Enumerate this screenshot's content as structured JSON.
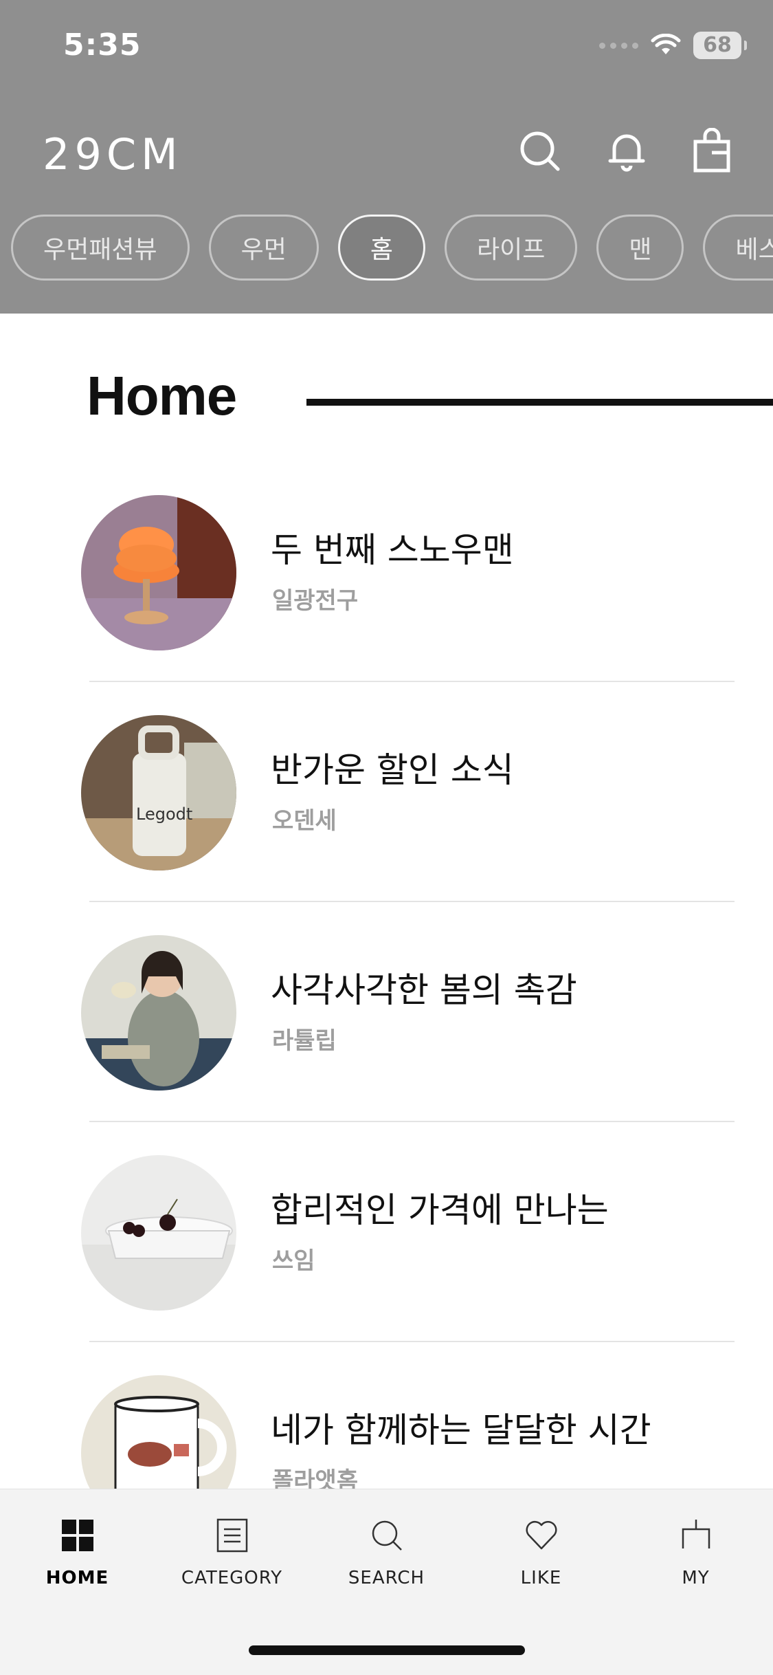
{
  "status_bar": {
    "time": "5:35",
    "battery": "68"
  },
  "header": {
    "logo": "29CM",
    "icons": [
      "search-icon",
      "bell-icon",
      "shopping-bag-icon"
    ],
    "chips": [
      {
        "label": "우먼패션뷰"
      },
      {
        "label": "우먼"
      },
      {
        "label": "홈",
        "active": true
      },
      {
        "label": "라이프"
      },
      {
        "label": "맨"
      },
      {
        "label": "베스"
      }
    ]
  },
  "section": {
    "title": "Home"
  },
  "items": [
    {
      "title": "두 번째 스노우맨",
      "brand": "일광전구"
    },
    {
      "title": "반가운 할인 소식",
      "brand": "오덴세"
    },
    {
      "title": "사각사각한 봄의 촉감",
      "brand": "라튤립"
    },
    {
      "title": "합리적인 가격에 만나는",
      "brand": "쓰임"
    },
    {
      "title": "네가 함께하는 달달한 시간",
      "brand": "폴라앳홈"
    }
  ],
  "thumb_labels": {
    "bottle": "Legodt"
  },
  "tabbar": {
    "tabs": [
      {
        "label": "HOME",
        "icon": "grid-icon",
        "active": true
      },
      {
        "label": "CATEGORY",
        "icon": "list-icon"
      },
      {
        "label": "SEARCH",
        "icon": "search-icon"
      },
      {
        "label": "LIKE",
        "icon": "heart-icon"
      },
      {
        "label": "MY",
        "icon": "user-icon"
      }
    ]
  },
  "colors": {
    "header_dim": "#8f8f8f",
    "text": "#111111",
    "muted": "#9e9e9e",
    "tabbar": "#f3f3f3"
  }
}
